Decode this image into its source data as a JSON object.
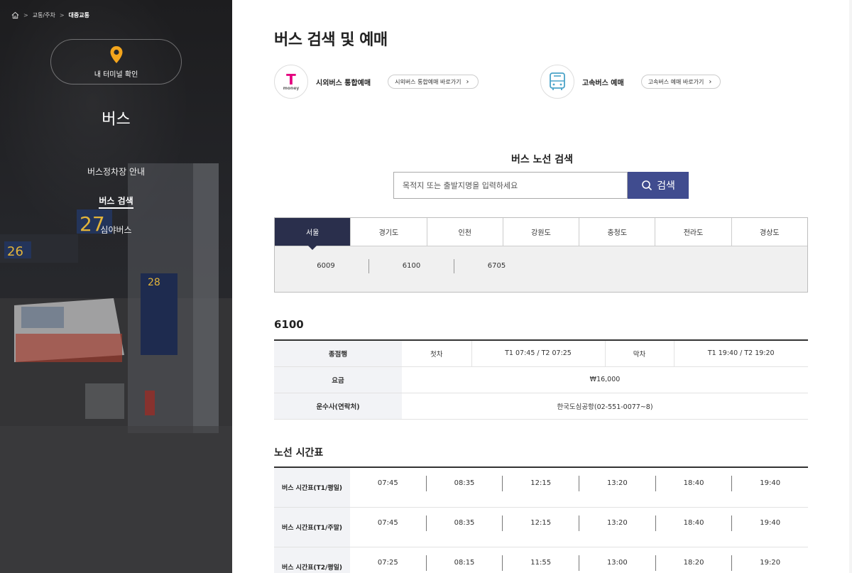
{
  "breadcrumb": {
    "items": [
      "교통/주차",
      "대중교통"
    ]
  },
  "sidebar": {
    "terminal_button": "내 터미널 확인",
    "title": "버스",
    "nav": [
      {
        "label": "버스정차장 안내",
        "active": false
      },
      {
        "label": "버스 검색",
        "active": true
      },
      {
        "label": "심야버스",
        "active": false
      }
    ]
  },
  "main": {
    "title": "버스 검색 및 예매",
    "booking": {
      "tmoney": {
        "logo_text": "money",
        "label": "시외버스 통합예매",
        "button": "시외버스 통합예매 바로가기"
      },
      "express": {
        "label": "고속버스 예매",
        "button": "고속버스 예매 바로가기"
      }
    },
    "route_search": {
      "title": "버스 노선 검색",
      "placeholder": "목적지 또는 출발지명을 입력하세요",
      "button": "검색"
    },
    "regions": [
      "서울",
      "경기도",
      "인천",
      "강원도",
      "충청도",
      "전라도",
      "경상도"
    ],
    "active_region": "서울",
    "routes": [
      "6009",
      "6100",
      "6705"
    ],
    "route_detail": {
      "name": "6100",
      "labels": {
        "terminal": "종점행",
        "first": "첫차",
        "last": "막차",
        "fare": "요금",
        "operator": "운수사(연락처)"
      },
      "first_time": "T1 07:45 / T2 07:25",
      "last_time": "T1 19:40 / T2 19:20",
      "fare": "₩16,000",
      "operator": "한국도심공항(02-551-0077~8)"
    },
    "timetable": {
      "title": "노선 시간표",
      "rows": [
        {
          "label": "버스 시간표(T1/평일)",
          "times": [
            "07:45",
            "08:35",
            "12:15",
            "13:20",
            "18:40",
            "19:40"
          ]
        },
        {
          "label": "버스 시간표(T1/주말)",
          "times": [
            "07:45",
            "08:35",
            "12:15",
            "13:20",
            "18:40",
            "19:40"
          ]
        },
        {
          "label": "버스 시간표(T2/평일)",
          "times": [
            "07:25",
            "08:15",
            "11:55",
            "13:00",
            "18:20",
            "19:20"
          ]
        }
      ]
    }
  },
  "colors": {
    "accent": "#404c8f",
    "tab_active": "#2a2f4c",
    "pin": "#f4a51c",
    "tmoney": "#e4007f"
  }
}
